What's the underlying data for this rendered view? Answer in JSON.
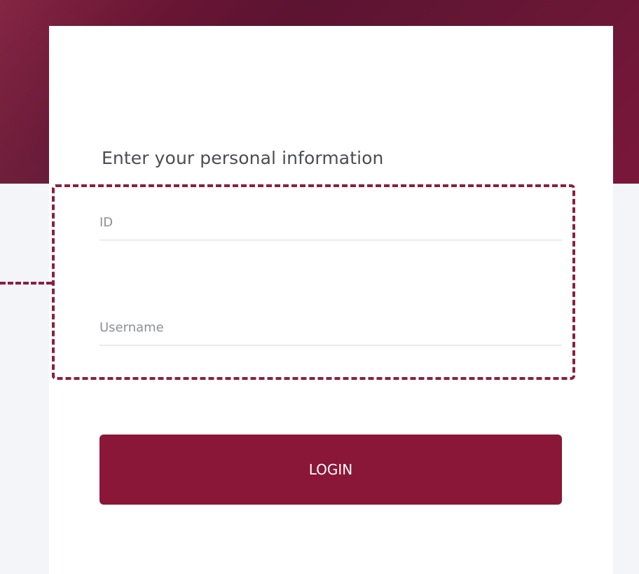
{
  "form": {
    "title": "Enter your personal information",
    "id_placeholder": "ID",
    "username_placeholder": "Username",
    "login_label": "LOGIN"
  },
  "colors": {
    "header_primary": "#6a1735",
    "header_secondary": "#7b1737",
    "accent": "#8a1737",
    "highlight": "#8a1f3f",
    "page_background": "#f4f5f9",
    "card_background": "#ffffff",
    "text_primary": "#4a4d55",
    "text_placeholder": "#8c9099"
  }
}
